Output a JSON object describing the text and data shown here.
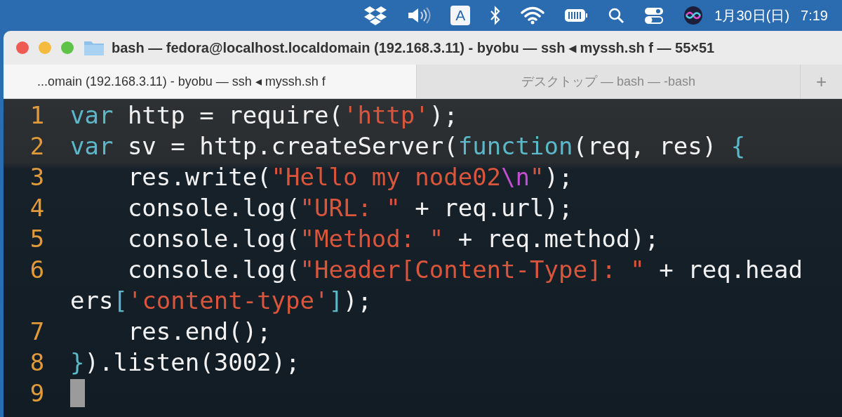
{
  "menu_bar": {
    "input_source": "A",
    "date": "1月30日(日)",
    "time": "7:19"
  },
  "window": {
    "title": "bash — fedora@localhost.localdomain (192.168.3.11) - byobu — ssh ◂ myssh.sh f — 55×51"
  },
  "tabs": [
    {
      "label": "...omain (192.168.3.11) - byobu — ssh ◂ myssh.sh f",
      "selected": true
    },
    {
      "label": "デスクトップ — bash — -bash",
      "selected": false
    }
  ],
  "new_tab_button": "+",
  "terminal": {
    "lines": [
      {
        "number": "1",
        "tokens": [
          {
            "kind": "keyword",
            "text": "var"
          },
          {
            "kind": "plain",
            "text": " http = require("
          },
          {
            "kind": "string",
            "text": "'http'"
          },
          {
            "kind": "plain",
            "text": ");"
          }
        ]
      },
      {
        "number": "2",
        "tokens": [
          {
            "kind": "keyword",
            "text": "var"
          },
          {
            "kind": "plain",
            "text": " sv = http.createServer("
          },
          {
            "kind": "keyword",
            "text": "function"
          },
          {
            "kind": "plain",
            "text": "(req, res) "
          },
          {
            "kind": "keyword",
            "text": "{"
          }
        ]
      },
      {
        "number": "3",
        "tokens": [
          {
            "kind": "plain",
            "text": "    res.write("
          },
          {
            "kind": "string",
            "text": "\"Hello my node02"
          },
          {
            "kind": "escape",
            "text": "\\n"
          },
          {
            "kind": "string",
            "text": "\""
          },
          {
            "kind": "plain",
            "text": ");"
          }
        ]
      },
      {
        "number": "4",
        "tokens": [
          {
            "kind": "plain",
            "text": "    console.log("
          },
          {
            "kind": "string",
            "text": "\"URL: \""
          },
          {
            "kind": "plain",
            "text": " + req.url);"
          }
        ]
      },
      {
        "number": "5",
        "tokens": [
          {
            "kind": "plain",
            "text": "    console.log("
          },
          {
            "kind": "string",
            "text": "\"Method: \""
          },
          {
            "kind": "plain",
            "text": " + req.method);"
          }
        ]
      },
      {
        "number": "6",
        "tokens": [
          {
            "kind": "plain",
            "text": "    console.log("
          },
          {
            "kind": "string",
            "text": "\"Header[Content-Type]: \""
          },
          {
            "kind": "plain",
            "text": " + req.head"
          }
        ]
      },
      {
        "tokens": [
          {
            "kind": "plain",
            "text": "ers"
          },
          {
            "kind": "keyword",
            "text": "["
          },
          {
            "kind": "string",
            "text": "'content-type'"
          },
          {
            "kind": "keyword",
            "text": "]"
          },
          {
            "kind": "plain",
            "text": ");"
          }
        ]
      },
      {
        "number": "7",
        "tokens": [
          {
            "kind": "plain",
            "text": "    res.end();"
          }
        ]
      },
      {
        "number": "8",
        "tokens": [
          {
            "kind": "keyword",
            "text": "}"
          },
          {
            "kind": "plain",
            "text": ").listen(3002);"
          }
        ]
      },
      {
        "number": "9",
        "cursor": true
      }
    ]
  }
}
